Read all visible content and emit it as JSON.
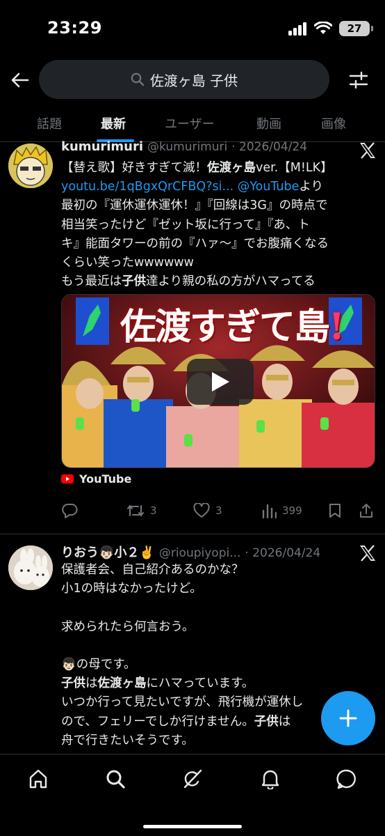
{
  "status_bar": {
    "time": "23:29",
    "battery": "27"
  },
  "search": {
    "query": "佐渡ヶ島 子供"
  },
  "tabs": [
    {
      "label": "話題"
    },
    {
      "label": "最新"
    },
    {
      "label": "ユーザー"
    },
    {
      "label": "動画"
    },
    {
      "label": "画像"
    }
  ],
  "active_tab": "最新",
  "tweets": [
    {
      "name": "kumurimuri",
      "handle": "@kumurimuri",
      "date": "· 2026/04/24",
      "text": {
        "l1a": "【替え歌】好きすぎて滅！",
        "l1b": "佐渡ヶ島",
        "l1c": "ver.【M!LK】",
        "link1": "youtu.be/1qBgxQrCFBQ?si...",
        "mention": "@YouTube",
        "l2c": "より",
        "body": "最初の『運休運休運休！』『回線は3G』の時点で\n相当笑ったけど『ゼット坂に行って』『あ、ト\nキ』能面タワーの前の『ハァ〜』でお腹痛くなる\nくらい笑ったwwwwww",
        "l7a": "もう最近は",
        "l7b": "子供",
        "l7c": "達より親の私の方がハマってる"
      },
      "media_title": "佐渡すぎて島",
      "media_title_mark": "!",
      "source": "YouTube",
      "retweets": "3",
      "likes": "3",
      "views": "399"
    },
    {
      "name": "りおう👦🏻小２✌️",
      "handle": "@rioupiyopi...",
      "date": "· 2026/04/24",
      "text": {
        "p1": "保護者会、自己紹介あるのかな？\n小1の時はなかったけど。\n\n求められたら何言おう。\n\n👦🏻の母です。",
        "l7a": "子供",
        "l7b": "は",
        "l7c": "佐渡ヶ島",
        "l7d": "にハマっています。",
        "l8": "いつか行って見たいですが、飛行機が運休し",
        "l9a": "ので、フェリーでしか行けません。",
        "l9b": "子供",
        "l9c": "は",
        "l10": "舟で行きたいそうです。"
      }
    }
  ],
  "colors": {
    "accent": "#1d9bf0",
    "background": "#000000",
    "muted": "#71767b"
  },
  "icons": {
    "back": "arrow-left-icon",
    "search": "search-icon",
    "filter": "sliders-icon",
    "x": "x-logo-icon",
    "reply": "reply-icon",
    "retweet": "retweet-icon",
    "like": "heart-icon",
    "views": "bar-chart-icon",
    "bookmark": "bookmark-icon",
    "share": "share-icon",
    "compose": "plus-icon",
    "home": "home-icon",
    "explore": "search-icon",
    "grok": "grok-icon",
    "notifications": "bell-icon",
    "messages": "message-icon"
  }
}
